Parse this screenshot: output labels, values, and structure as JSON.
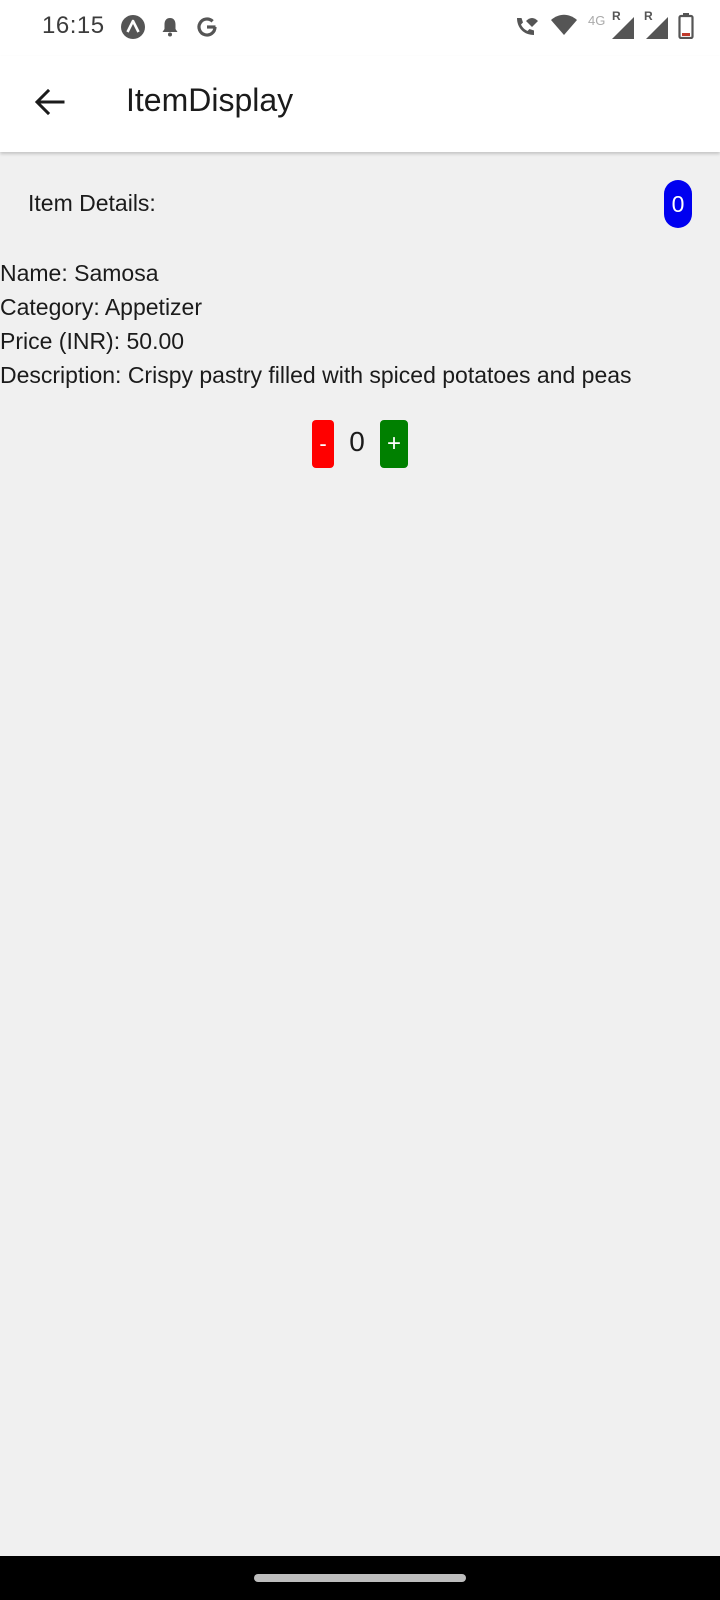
{
  "status_bar": {
    "time": "16:15",
    "left_icons": [
      "app-a-icon",
      "notification-bell-icon",
      "google-g-icon"
    ],
    "right_icons": [
      "wifi-call-icon",
      "wifi-icon",
      "signal-4g-icon",
      "signal-roaming-icon",
      "battery-icon"
    ],
    "network_label": "4G",
    "roaming_label": "R"
  },
  "app_bar": {
    "back_icon": "arrow-back-icon",
    "title": "ItemDisplay"
  },
  "content": {
    "details_header": "Item Details:",
    "cart_count": "0",
    "item": {
      "name_line": "Name: Samosa",
      "category_line": "Category: Appetizer",
      "price_line": "Price (INR): 50.00",
      "description_line": "Description: Crispy pastry filled with spiced potatoes and peas"
    },
    "quantity": {
      "minus_label": "-",
      "value": "0",
      "plus_label": "+"
    }
  },
  "colors": {
    "badge": "#0000f0",
    "minus_button": "#ff0000",
    "plus_button": "#008000",
    "background": "#f0f0f0"
  }
}
